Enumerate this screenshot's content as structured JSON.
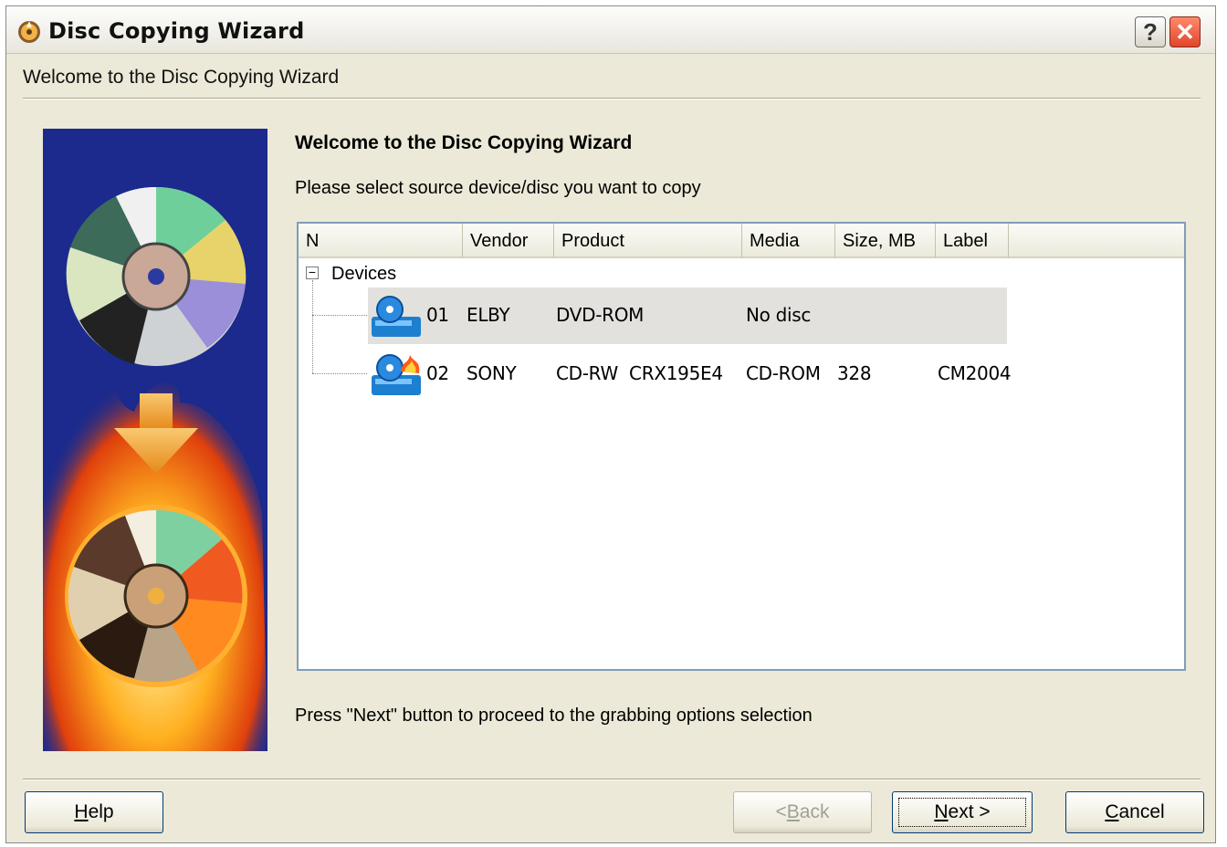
{
  "window": {
    "title": "Disc Copying Wizard",
    "help_glyph": "?",
    "close_glyph": "✕"
  },
  "subtitle": "Welcome to the Disc Copying Wizard",
  "main": {
    "heading": "Welcome to the Disc Copying Wizard",
    "instruction": "Please select source device/disc you want to copy",
    "footer_text": "Press \"Next\" button to proceed to the grabbing options selection"
  },
  "list": {
    "columns": [
      "N",
      "Vendor",
      "Product",
      "Media",
      "Size, MB",
      "Label"
    ],
    "root_label": "Devices",
    "root_expander": "−",
    "rows": [
      {
        "n": "01",
        "vendor": "ELBY",
        "product": "DVD-ROM",
        "media": "No disc",
        "size": "",
        "label": "",
        "icon": "dvd-drive-icon",
        "selected": true
      },
      {
        "n": "02",
        "vendor": "SONY",
        "product": "CD-RW  CRX195E4",
        "media": "CD-ROM",
        "size": "328",
        "label": "CM2004",
        "icon": "cd-writer-icon",
        "selected": false
      }
    ]
  },
  "buttons": {
    "help": {
      "prefix": "",
      "key": "H",
      "suffix": "elp"
    },
    "back": {
      "prefix": "< ",
      "key": "B",
      "suffix": "ack"
    },
    "next": {
      "prefix": "",
      "key": "N",
      "suffix": "ext >"
    },
    "cancel": {
      "prefix": "",
      "key": "C",
      "suffix": "ancel"
    }
  },
  "colors": {
    "window_bg": "#ece9d8",
    "side_panel_bg": "#1b2a8c",
    "selected_row": "#e2e1dd",
    "close_button": "#e0452c"
  }
}
